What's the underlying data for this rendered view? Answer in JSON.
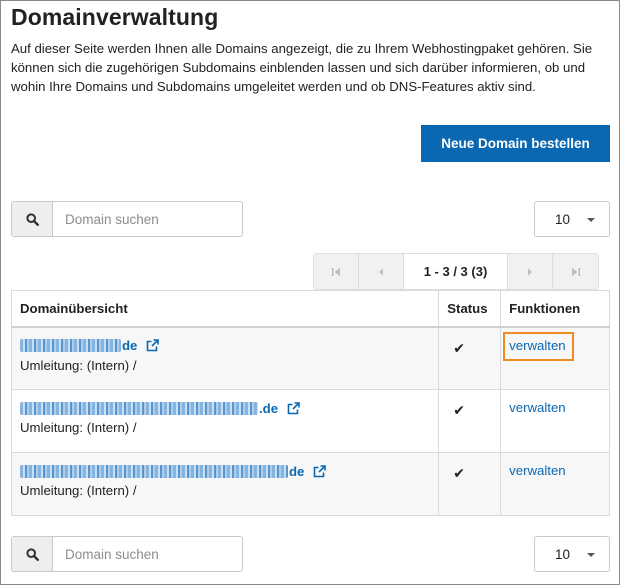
{
  "header": {
    "title": "Domainverwaltung",
    "intro": "Auf dieser Seite werden Ihnen alle Domains angezeigt, die zu Ihrem Webhostingpaket gehören. Sie können sich die zugehörigen Subdomains einblenden lassen und sich darüber informieren, ob und wohin Ihre Domains und Subdomains umgeleitet werden und ob DNS-Features aktiv sind."
  },
  "actions": {
    "order_label": "Neue Domain bestellen"
  },
  "search_top": {
    "placeholder": "Domain suchen",
    "icon": "search-icon"
  },
  "search_bottom": {
    "placeholder": "Domain suchen",
    "icon": "search-icon"
  },
  "page_size_top": {
    "value": "10"
  },
  "page_size_bottom": {
    "value": "10"
  },
  "pagination": {
    "info": "1 - 3 / 3 (3)"
  },
  "table": {
    "headers": {
      "domain": "Domainübersicht",
      "status": "Status",
      "functions": "Funktionen"
    },
    "rows": [
      {
        "tld": "de",
        "redirect": "Umleitung: (Intern) /",
        "status": "✔",
        "action": "verwalten"
      },
      {
        "tld": ".de",
        "redirect": "Umleitung: (Intern) /",
        "status": "✔",
        "action": "verwalten"
      },
      {
        "tld": "de",
        "redirect": "Umleitung: (Intern) /",
        "status": "✔",
        "action": "verwalten"
      }
    ]
  },
  "colors": {
    "accent": "#0a67b2",
    "highlight": "#f08a24"
  }
}
